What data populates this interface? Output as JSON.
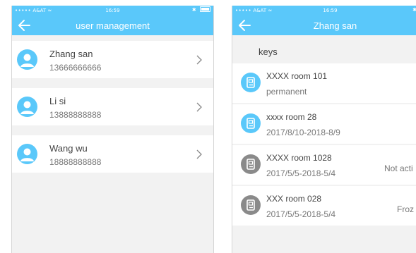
{
  "left_screen": {
    "status_bar": {
      "signal": "•••••",
      "carrier": "A&AT",
      "time": "16:59"
    },
    "nav": {
      "title": "user management",
      "back_icon": "arrow-left-icon"
    },
    "users": [
      {
        "name": "Zhang san",
        "phone": "13666666666"
      },
      {
        "name": "Li si",
        "phone": "13888888888"
      },
      {
        "name": "Wang wu",
        "phone": "18888888888"
      }
    ]
  },
  "right_screen": {
    "status_bar": {
      "signal": "•••••",
      "carrier": "A&AT",
      "time": "16:59"
    },
    "nav": {
      "title": "Zhang san",
      "back_icon": "arrow-left-icon"
    },
    "section_label": "keys",
    "keys": [
      {
        "room": "XXXX room 101",
        "validity": "permanent",
        "status": "",
        "icon_state": "active"
      },
      {
        "room": "xxxx room 28",
        "validity": "2017/8/10-2018-8/9",
        "status": "",
        "icon_state": "active"
      },
      {
        "room": "XXXX room 1028",
        "validity": "2017/5/5-2018-5/4",
        "status": "Not acti",
        "icon_state": "inactive"
      },
      {
        "room": "XXX room 028",
        "validity": "2017/5/5-2018-5/4",
        "status": "Froz",
        "icon_state": "inactive"
      }
    ]
  },
  "colors": {
    "accent": "#5ac8fa",
    "inactive_icon": "#8a8a8a",
    "background": "#f2f2f2"
  }
}
